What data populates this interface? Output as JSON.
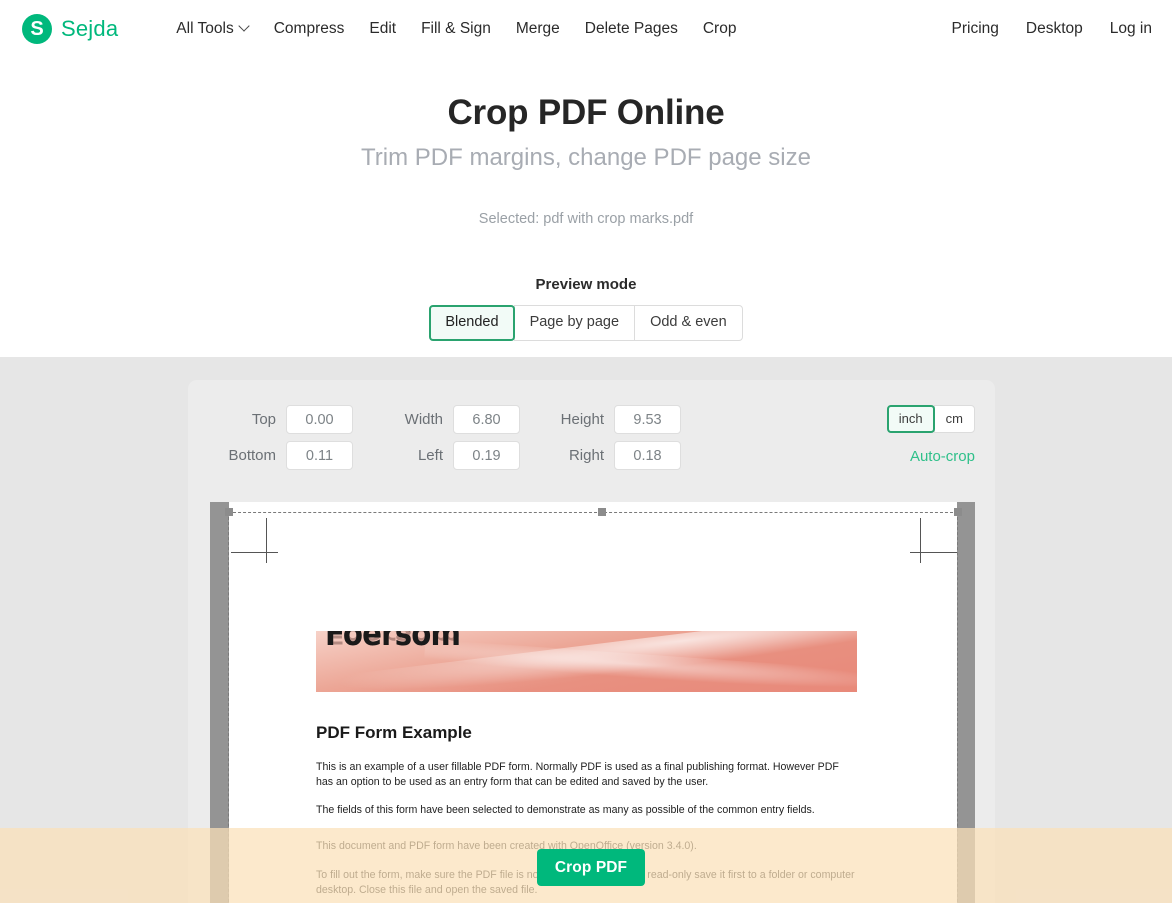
{
  "header": {
    "brand": {
      "mark": "S",
      "name": "Sejda"
    },
    "nav_main": [
      {
        "label": "All Tools",
        "has_caret": true
      },
      {
        "label": "Compress",
        "has_caret": false
      },
      {
        "label": "Edit",
        "has_caret": false
      },
      {
        "label": "Fill & Sign",
        "has_caret": false
      },
      {
        "label": "Merge",
        "has_caret": false
      },
      {
        "label": "Delete Pages",
        "has_caret": false
      },
      {
        "label": "Crop",
        "has_caret": false
      }
    ],
    "nav_right": [
      {
        "label": "Pricing"
      },
      {
        "label": "Desktop"
      },
      {
        "label": "Log in"
      }
    ]
  },
  "hero": {
    "title": "Crop PDF Online",
    "subtitle": "Trim PDF margins, change PDF page size",
    "selected_file": "Selected: pdf with crop marks.pdf"
  },
  "preview_mode": {
    "label": "Preview mode",
    "options": [
      {
        "label": "Blended",
        "selected": true
      },
      {
        "label": "Page by page",
        "selected": false
      },
      {
        "label": "Odd & even",
        "selected": false
      }
    ]
  },
  "crop_controls": {
    "fields": [
      {
        "label": "Top",
        "value": "0.00"
      },
      {
        "label": "Width",
        "value": "6.80"
      },
      {
        "label": "Height",
        "value": "9.53"
      },
      {
        "label": "Bottom",
        "value": "0.11"
      },
      {
        "label": "Left",
        "value": "0.19"
      },
      {
        "label": "Right",
        "value": "0.18"
      }
    ],
    "units": [
      {
        "label": "inch",
        "selected": true
      },
      {
        "label": "cm",
        "selected": false
      }
    ],
    "auto_crop_label": "Auto-crop"
  },
  "pdf_preview": {
    "banner_word": "Foersom",
    "heading": "PDF Form Example",
    "paragraphs": [
      "This is an example of a user fillable PDF form. Normally PDF is used as a final publishing format. However PDF has an option to be used as an entry form that can be edited and saved by the user.",
      "The fields of this form have been selected to demonstrate as many as possible of the common entry fields.",
      "This document and PDF form have been created with OpenOffice (version 3.4.0).",
      "To fill out the form, make sure the PDF file is not read-only. If the file is read-only save it first to a folder or computer desktop. Close this file and open the saved file."
    ]
  },
  "actions": {
    "crop_button": "Crop PDF"
  },
  "colors": {
    "brand_green": "#00b87c",
    "accent_green": "#2aa36f",
    "link_green": "#2fc08a",
    "work_bg": "#e6e6e6",
    "card_bg": "#ececec",
    "bottom_overlay": "#fbe0b9"
  }
}
